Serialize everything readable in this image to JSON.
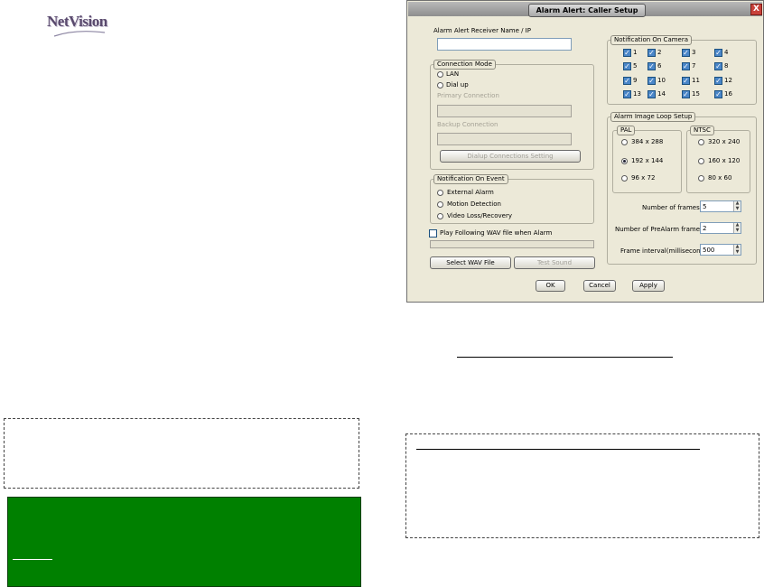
{
  "logo": {
    "text": "NetVision"
  },
  "dialog": {
    "title": "Alarm Alert: Caller Setup",
    "close_label": "X",
    "receiver_label": "Alarm Alert Receiver Name / IP",
    "receiver_value": "",
    "connection_mode": {
      "title": "Connection Mode",
      "options": [
        "LAN",
        "Dial up"
      ],
      "primary_label": "Primary Connection",
      "backup_label": "Backup Connection",
      "dialup_button": "Dialup Connections Setting"
    },
    "notification_event": {
      "title": "Notification On Event",
      "items": [
        "External Alarm",
        "Motion Detection",
        "Video Loss/Recovery"
      ]
    },
    "play_wav_label": "Play Following WAV file when Alarm",
    "select_wav_button": "Select WAV File",
    "test_sound_button": "Test Sound",
    "notification_camera": {
      "title": "Notification On Camera",
      "cameras": [
        "1",
        "2",
        "3",
        "4",
        "5",
        "6",
        "7",
        "8",
        "9",
        "10",
        "11",
        "12",
        "13",
        "14",
        "15",
        "16"
      ]
    },
    "image_loop": {
      "title": "Alarm Image Loop Setup",
      "pal_title": "PAL",
      "pal_options": [
        "384 x 288",
        "192 x 144",
        "96 x 72"
      ],
      "pal_selected": "192 x 144",
      "ntsc_title": "NTSC",
      "ntsc_options": [
        "320 x 240",
        "160 x 120",
        "80 x 60"
      ],
      "frames_label": "Number of frames:",
      "frames_value": "5",
      "prealarm_label": "Number of PreAlarm frames:",
      "prealarm_value": "2",
      "interval_label": "Frame interval(millisecond)",
      "interval_value": "500"
    },
    "ok_button": "OK",
    "cancel_button": "Cancel",
    "apply_button": "Apply"
  },
  "colors": {
    "green_panel": "#008000",
    "dialog_bg": "#ece9d8",
    "checkbox_blue": "#4a86c8"
  }
}
